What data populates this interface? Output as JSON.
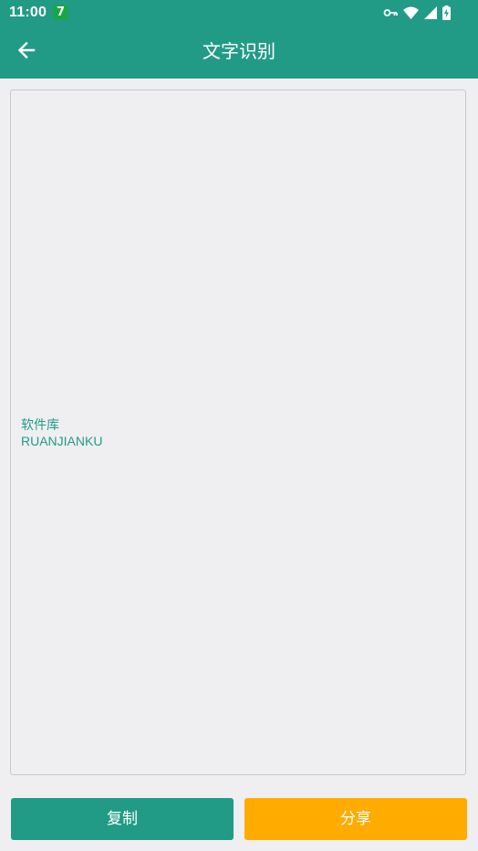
{
  "status_bar": {
    "time": "11:00",
    "notification_badge": "7",
    "icons": [
      "vpn-key-icon",
      "wifi-icon",
      "cell-signal-icon",
      "battery-charging-icon"
    ]
  },
  "header": {
    "title": "文字识别",
    "back_icon": "arrow-back-icon",
    "background_color": "#229b86"
  },
  "result": {
    "lines": [
      "软件库",
      "RUANJIANKU"
    ],
    "text_color": "#229b86"
  },
  "actions": {
    "copy_label": "复制",
    "share_label": "分享",
    "copy_color": "#229b86",
    "share_color": "#ffab00"
  }
}
